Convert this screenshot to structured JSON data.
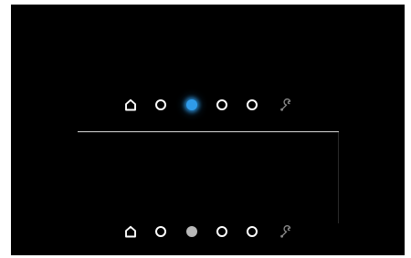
{
  "screen": {
    "background": "#000000",
    "accent": "#2f9bea",
    "inactive_fill": "#b8b8b8",
    "icon_color": "#ffffff",
    "wrench_color": "#8a8a8a"
  },
  "top_dock": {
    "items": [
      {
        "icon": "home-icon",
        "state": "outline"
      },
      {
        "icon": "circle-icon",
        "state": "outline"
      },
      {
        "icon": "circle-icon",
        "state": "selected"
      },
      {
        "icon": "circle-icon",
        "state": "outline"
      },
      {
        "icon": "circle-icon",
        "state": "outline"
      },
      {
        "icon": "wrench-icon",
        "state": "dim"
      }
    ]
  },
  "bottom_dock": {
    "items": [
      {
        "icon": "home-icon",
        "state": "outline"
      },
      {
        "icon": "circle-icon",
        "state": "outline"
      },
      {
        "icon": "circle-icon",
        "state": "filled-grey"
      },
      {
        "icon": "circle-icon",
        "state": "outline"
      },
      {
        "icon": "circle-icon",
        "state": "outline"
      },
      {
        "icon": "wrench-icon",
        "state": "dim"
      }
    ]
  }
}
